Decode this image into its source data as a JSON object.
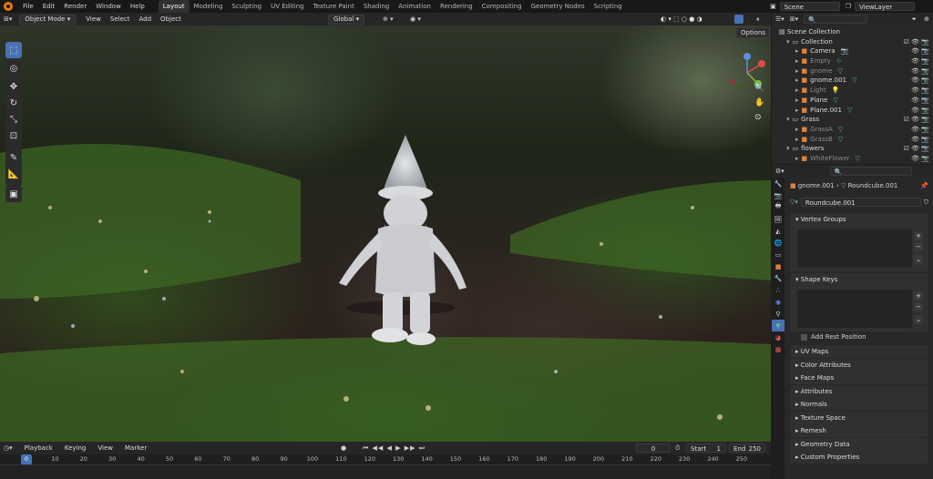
{
  "topbar": {
    "menus": [
      "File",
      "Edit",
      "Render",
      "Window",
      "Help"
    ],
    "workspaces": [
      "Layout",
      "Modeling",
      "Sculpting",
      "UV Editing",
      "Texture Paint",
      "Shading",
      "Animation",
      "Rendering",
      "Compositing",
      "Geometry Nodes",
      "Scripting"
    ],
    "active_workspace": "Layout",
    "scene": "Scene",
    "view_layer": "ViewLayer"
  },
  "viewport_header": {
    "mode": "Object Mode",
    "menus": [
      "View",
      "Select",
      "Add",
      "Object"
    ],
    "orientation": "Global",
    "options": "Options"
  },
  "outliner": {
    "root": "Scene Collection",
    "rows": [
      {
        "label": "Collection",
        "level": 1,
        "dim": false,
        "color": "#d9d9d9"
      },
      {
        "label": "Camera",
        "level": 2,
        "dim": false,
        "color": "#d9d9d9"
      },
      {
        "label": "Empty",
        "level": 2,
        "dim": true,
        "color": "#8b8b8b"
      },
      {
        "label": "gnome",
        "level": 2,
        "dim": true,
        "color": "#8b8b8b"
      },
      {
        "label": "gnome.001",
        "level": 2,
        "dim": false,
        "color": "#d9d9d9"
      },
      {
        "label": "Light",
        "level": 2,
        "dim": true,
        "color": "#8b8b8b"
      },
      {
        "label": "Plane",
        "level": 2,
        "dim": false,
        "color": "#d9d9d9"
      },
      {
        "label": "Plane.001",
        "level": 2,
        "dim": false,
        "color": "#d9d9d9"
      },
      {
        "label": "Grass",
        "level": 1,
        "dim": false,
        "color": "#d9d9d9"
      },
      {
        "label": "GrassA",
        "level": 2,
        "dim": true,
        "color": "#8b8b8b"
      },
      {
        "label": "GrassB",
        "level": 2,
        "dim": true,
        "color": "#8b8b8b"
      },
      {
        "label": "flowers",
        "level": 1,
        "dim": false,
        "color": "#d9d9d9"
      },
      {
        "label": "WhiteFlower",
        "level": 2,
        "dim": true,
        "color": "#8b8b8b"
      }
    ]
  },
  "properties": {
    "breadcrumb_object": "gnome.001",
    "breadcrumb_mesh": "Roundcube.001",
    "mesh_name": "Roundcube.001",
    "panels": {
      "vertex_groups": "Vertex Groups",
      "shape_keys": "Shape Keys",
      "add_rest_position": "Add Rest Position"
    },
    "collapsed_panels": [
      "UV Maps",
      "Color Attributes",
      "Face Maps",
      "Attributes",
      "Normals",
      "Texture Space",
      "Remesh",
      "Geometry Data",
      "Custom Properties"
    ]
  },
  "timeline": {
    "menus": [
      "Playback",
      "Keying",
      "View",
      "Marker"
    ],
    "current_frame": "0",
    "start_label": "Start",
    "start": "1",
    "end_label": "End",
    "end": "250",
    "ruler": [
      "0",
      "10",
      "20",
      "30",
      "40",
      "50",
      "60",
      "70",
      "80",
      "90",
      "100",
      "110",
      "120",
      "130",
      "140",
      "150",
      "160",
      "170",
      "180",
      "190",
      "200",
      "210",
      "220",
      "230",
      "240",
      "250"
    ]
  },
  "colors": {
    "accent": "#4772b3",
    "blender_orange": "#e87d0d",
    "object_orange": "#e0843a",
    "mesh_green": "#5cbc8a"
  }
}
